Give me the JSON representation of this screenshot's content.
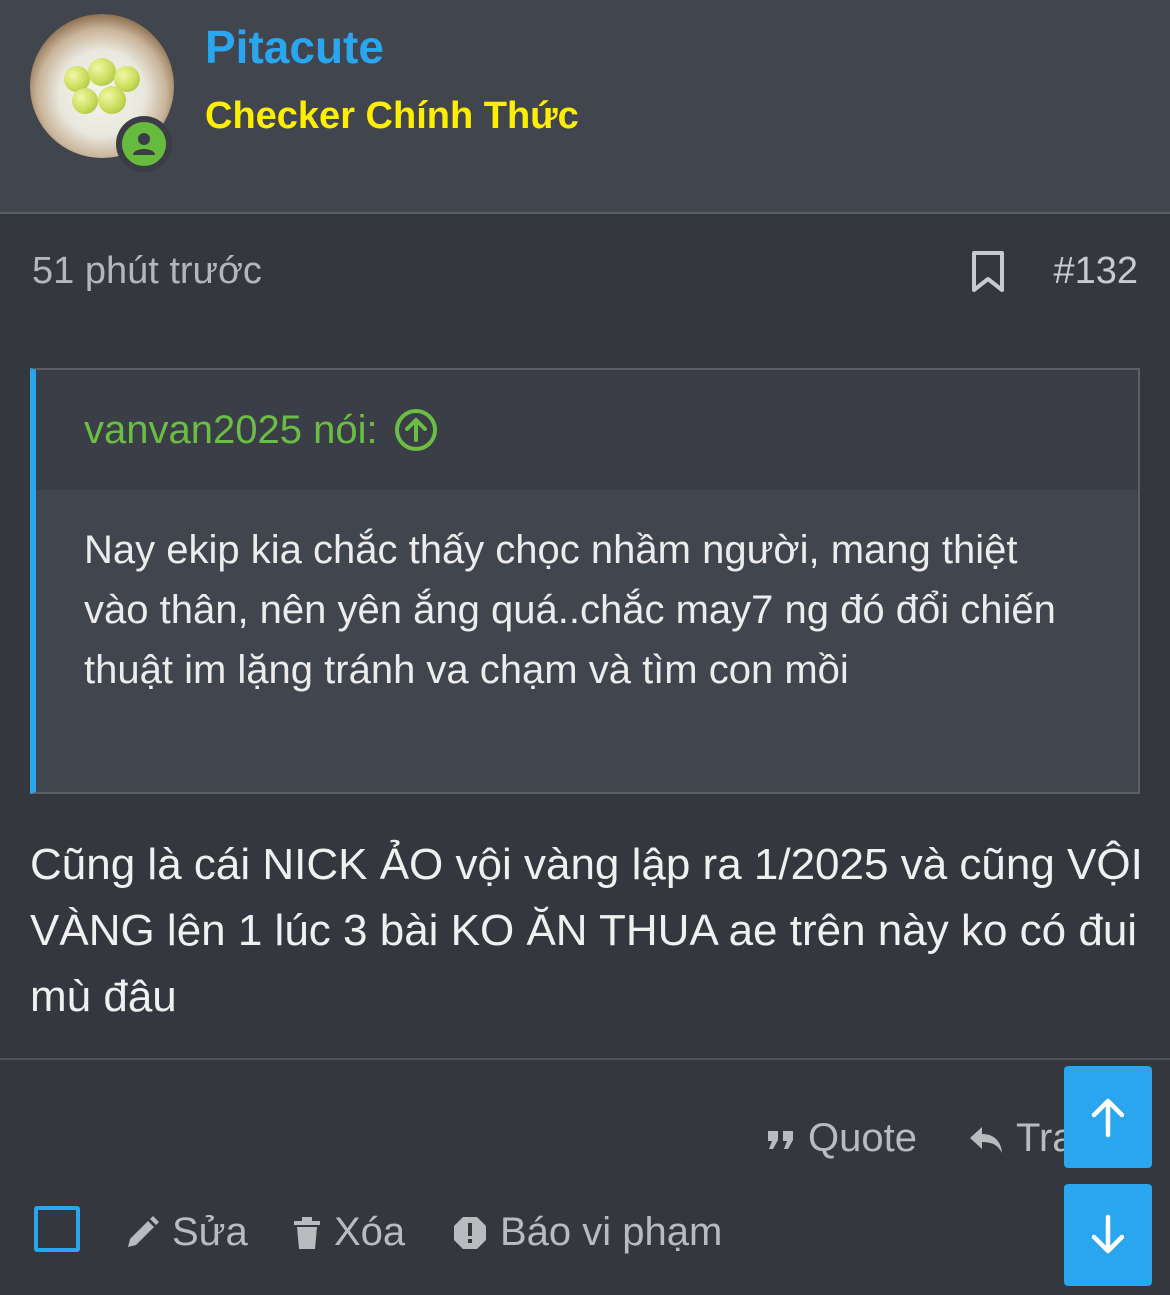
{
  "user": {
    "name": "Pitacute",
    "title": "Checker Chính Thức",
    "avatar_icon": "avatar-image",
    "status_icon": "online-user-icon"
  },
  "post": {
    "time": "51 phút trước",
    "number": "#132",
    "body": "Cũng là cái NICK ẢO vội vàng lập ra 1/2025 và cũng VỘI VÀNG lên 1 lúc 3 bài KO ĂN THUA ae trên này ko có đui mù đâu"
  },
  "quote": {
    "author_label": "vanvan2025 nói:",
    "text": "Nay ekip kia chắc thấy chọc nhầm người, mang thiệt vào thân, nên yên ắng quá..chắc may7 ng đó đổi chiến thuật im lặng tránh va chạm và tìm con mồi"
  },
  "actions": {
    "quote": "Quote",
    "reply": "Tra",
    "edit": "Sửa",
    "delete": "Xóa",
    "report": "Báo vi phạm"
  },
  "colors": {
    "accent": "#2aa6ef",
    "title": "#ffee00",
    "quote_author": "#6abd45",
    "background": "#34373e"
  }
}
